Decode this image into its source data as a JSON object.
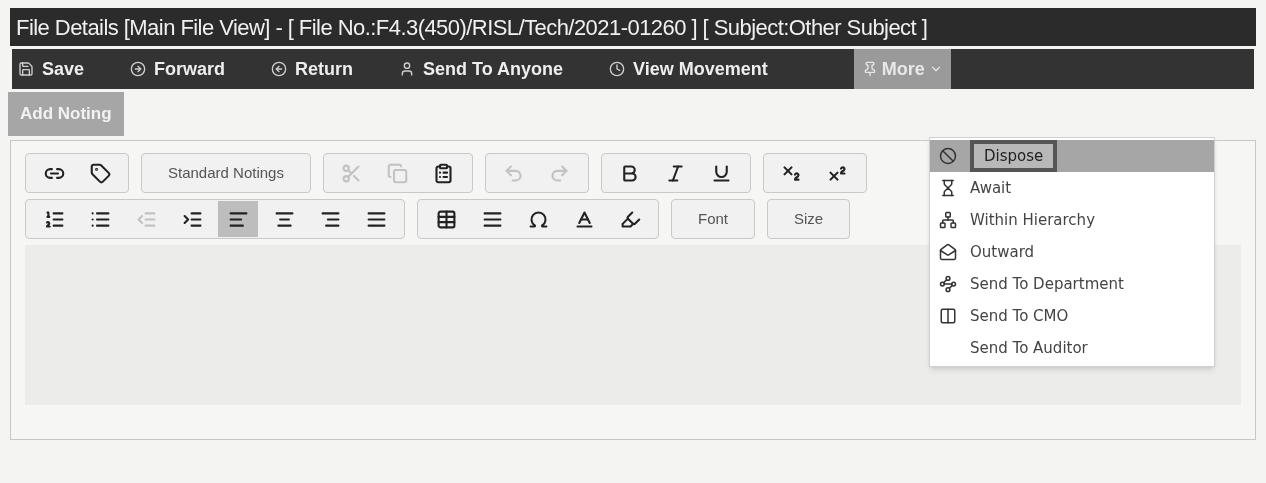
{
  "window": {
    "title": "File Details [Main File View] - [ File No.:F4.3(450)/RISL/Tech/2021-01260 ] [ Subject:Other Subject ]"
  },
  "toolbar": [
    {
      "label": "Save",
      "kind": "action"
    },
    {
      "label": "Forward",
      "kind": "action"
    },
    {
      "label": "Return",
      "kind": "action"
    },
    {
      "label": "Send To Anyone",
      "kind": "action"
    },
    {
      "label": "View Movement",
      "kind": "action"
    },
    {
      "label": "More",
      "kind": "menu",
      "expanded": true
    }
  ],
  "tabs": [
    {
      "label": "Add Noting",
      "selected": true
    }
  ],
  "editor_toolbar": [
    [
      [
        {
          "kind": "icon",
          "disabled": false
        },
        {
          "kind": "icon",
          "disabled": false
        }
      ],
      [
        {
          "kind": "text",
          "label": "Standard Notings"
        }
      ],
      [
        {
          "kind": "icon",
          "disabled": true
        },
        {
          "kind": "icon",
          "disabled": true
        },
        {
          "kind": "icon",
          "disabled": false
        }
      ],
      [
        {
          "kind": "icon",
          "disabled": true
        },
        {
          "kind": "icon",
          "disabled": true
        }
      ],
      [
        {
          "kind": "icon",
          "disabled": false
        },
        {
          "kind": "icon",
          "disabled": false
        },
        {
          "kind": "icon",
          "disabled": false
        }
      ],
      [
        {
          "kind": "icon",
          "disabled": false
        },
        {
          "kind": "icon",
          "disabled": false
        }
      ]
    ],
    [
      [
        {
          "kind": "icon",
          "disabled": false,
          "selected": false
        },
        {
          "kind": "icon",
          "disabled": false,
          "selected": false
        },
        {
          "kind": "icon",
          "disabled": true,
          "selected": false
        },
        {
          "kind": "icon",
          "disabled": false,
          "selected": false
        },
        {
          "kind": "icon",
          "disabled": false,
          "selected": true
        },
        {
          "kind": "icon",
          "disabled": false,
          "selected": false
        },
        {
          "kind": "icon",
          "disabled": false,
          "selected": false
        },
        {
          "kind": "icon",
          "disabled": false,
          "selected": false
        }
      ],
      [
        {
          "kind": "icon",
          "disabled": false
        },
        {
          "kind": "icon",
          "disabled": false
        },
        {
          "kind": "icon",
          "disabled": false
        },
        {
          "kind": "icon",
          "disabled": false
        },
        {
          "kind": "icon",
          "disabled": false
        }
      ],
      [
        {
          "kind": "text",
          "label": "Font"
        }
      ],
      [
        {
          "kind": "text",
          "label": "Size"
        }
      ]
    ]
  ],
  "more_menu": [
    {
      "label": "Dispose",
      "selected": true
    },
    {
      "label": "Await",
      "selected": false
    },
    {
      "label": "Within Hierarchy",
      "selected": false
    },
    {
      "label": "Outward",
      "selected": false
    },
    {
      "label": "Send To Department",
      "selected": false
    },
    {
      "label": "Send To CMO",
      "selected": false
    },
    {
      "label": "Send To Auditor",
      "selected": false
    }
  ]
}
